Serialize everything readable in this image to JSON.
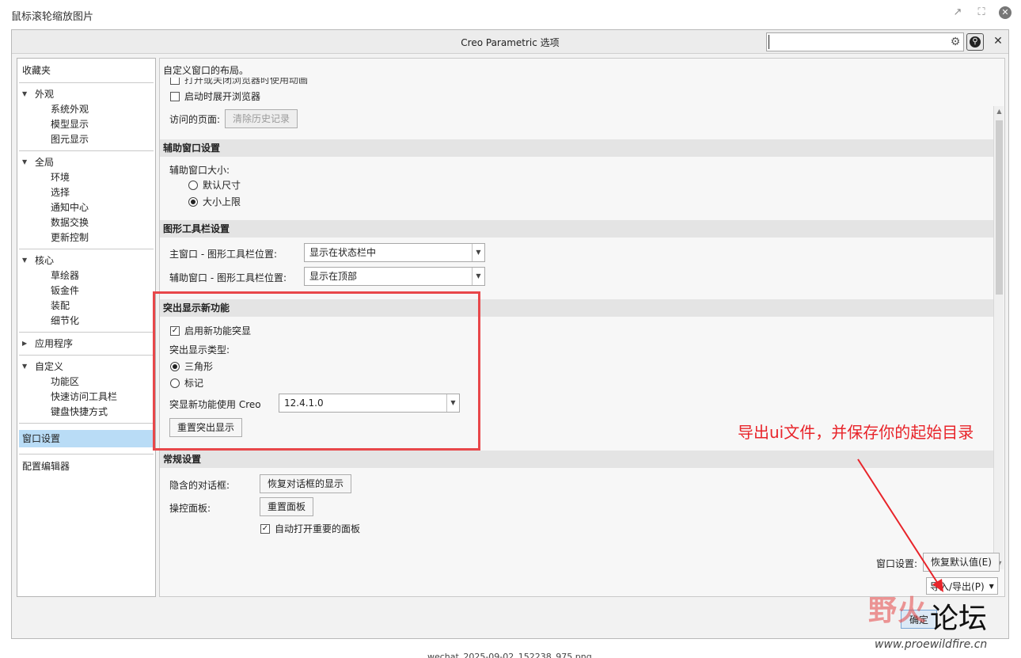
{
  "viewer": {
    "title": "鼠标滚轮缩放图片"
  },
  "dialog": {
    "title": "Creo Parametric 选项",
    "search_value": ""
  },
  "nav": {
    "favorites": "收藏夹",
    "groups": [
      {
        "label": "外观",
        "items": [
          "系统外观",
          "模型显示",
          "图元显示"
        ]
      },
      {
        "label": "全局",
        "items": [
          "环境",
          "选择",
          "通知中心",
          "数据交换",
          "更新控制"
        ]
      },
      {
        "label": "核心",
        "items": [
          "草绘器",
          "钣金件",
          "装配",
          "细节化"
        ]
      },
      {
        "label": "应用程序",
        "items": []
      },
      {
        "label": "自定义",
        "items": [
          "功能区",
          "快速访问工具栏",
          "键盘快捷方式"
        ]
      }
    ],
    "selected": "窗口设置",
    "config_editor": "配置编辑器"
  },
  "content": {
    "description": "自定义窗口的布局。",
    "partial_option": "打开或关闭浏览器时使用动画",
    "expand_browser": "启动时展开浏览器",
    "visited_pages_label": "访问的页面:",
    "clear_history": "清除历史记录",
    "aux_section": "辅助窗口设置",
    "aux_size_label": "辅助窗口大小:",
    "aux_default": "默认尺寸",
    "aux_max": "大小上限",
    "toolbar_section": "图形工具栏设置",
    "main_toolbar_label": "主窗口 - 图形工具栏位置:",
    "main_toolbar_value": "显示在状态栏中",
    "aux_toolbar_label": "辅助窗口 - 图形工具栏位置:",
    "aux_toolbar_value": "显示在顶部",
    "highlight_section": "突出显示新功能",
    "enable_highlight": "启用新功能突显",
    "highlight_type_label": "突出显示类型:",
    "type_triangle": "三角形",
    "type_mark": "标记",
    "creo_version_label": "突显新功能使用 Creo",
    "creo_version_value": "12.4.1.0",
    "reset_highlight": "重置突出显示",
    "general_section": "常规设置",
    "hidden_dialog_label": "隐含的对话框:",
    "restore_dialog": "恢复对话框的显示",
    "control_panel_label": "操控面板:",
    "reset_panel": "重置面板",
    "auto_open_panel": "自动打开重要的面板"
  },
  "footer": {
    "window_settings_label": "窗口设置:",
    "restore_defaults": "恢复默认值(E)",
    "import_export": "导入/导出(P)",
    "ok": "确定"
  },
  "annotation": {
    "text": "导出ui文件，并保存你的起始目录",
    "color": "#e8242a"
  },
  "watermark": {
    "brand": "野火",
    "forum": "论坛",
    "url": "www.proewildfire.cn"
  },
  "caption": "wechat_2025-09-02_152238_975.png"
}
